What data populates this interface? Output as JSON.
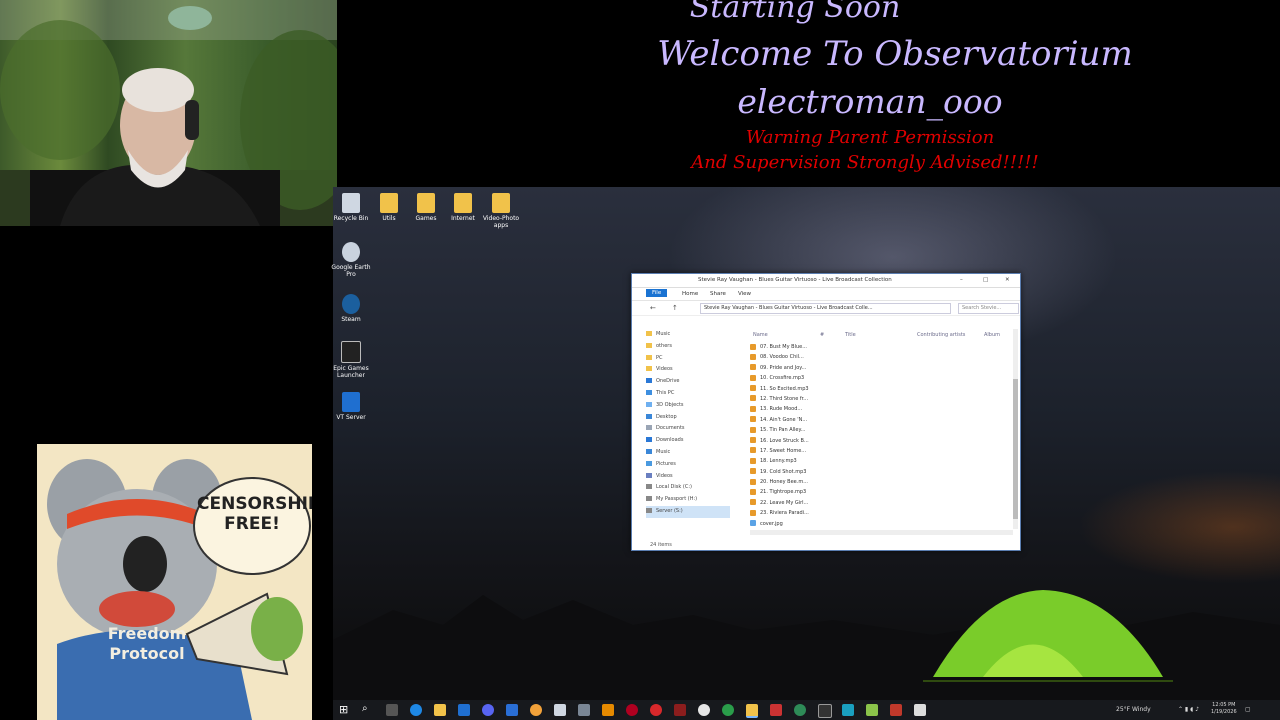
{
  "overlay": {
    "line1": "Starting Soon",
    "line2": "Welcome To Observatorium",
    "line3": "electroman_ooo",
    "warning1": "Warning Parent Permission",
    "warning2": "And Supervision Strongly Advised!!!!!"
  },
  "desktop_icons": [
    {
      "label": "Recycle Bin",
      "icon": "recycle-bin-icon"
    },
    {
      "label": "Utils",
      "icon": "folder-icon"
    },
    {
      "label": "Games",
      "icon": "folder-icon"
    },
    {
      "label": "Internet",
      "icon": "folder-icon"
    },
    {
      "label": "Video-Photo apps",
      "icon": "folder-icon"
    },
    {
      "label": "Google Earth Pro",
      "icon": "google-earth-icon"
    },
    {
      "label": "Steam",
      "icon": "steam-icon"
    },
    {
      "label": "Epic Games Launcher",
      "icon": "epic-games-icon"
    },
    {
      "label": "VT Server",
      "icon": "download-icon"
    }
  ],
  "explorer": {
    "title": "Stevie Ray Vaughan - Blues Guitar Virtuoso - Live Broadcast Collection",
    "ribbon": [
      "File",
      "Home",
      "Share",
      "View"
    ],
    "address": "Stevie Ray Vaughan - Blues Guitar Virtuoso - Live Broadcast Colle...",
    "search_placeholder": "Search Stevie...",
    "nav": [
      "Music",
      "others",
      "PC",
      "Videos",
      "OneDrive",
      "This PC",
      "3D Objects",
      "Desktop",
      "Documents",
      "Downloads",
      "Music",
      "Pictures",
      "Videos",
      "Local Disk (C:)",
      "My Passport (H:)",
      "Server (S:)"
    ],
    "columns": [
      "Name",
      "#",
      "Title",
      "Contributing artists",
      "Album"
    ],
    "files": [
      "07. Bust My Blue...",
      "08. Voodoo Chil...",
      "09. Pride and Joy...",
      "10. Crossfire.mp3",
      "11. So Excited.mp3",
      "12. Third Stone fr...",
      "13. Rude Mood...",
      "14. Ain't Gone 'N...",
      "15. Tin Pan Alley...",
      "16. Love Struck B...",
      "17. Sweet Home...",
      "18. Lenny.mp3",
      "19. Cold Shot.mp3",
      "20. Honey Bee.m...",
      "21. Tightrope.mp3",
      "22. Leave My Girl...",
      "23. Riviera Paradi...",
      "cover.jpg"
    ],
    "status": "24 items"
  },
  "sticker": {
    "bubble": "CENSORSHIP FREE!",
    "shirt": "Freedom Protocol"
  },
  "taskbar": {
    "weather": "25°F Windy",
    "time": "12:05 PM",
    "date": "1/19/2026"
  }
}
